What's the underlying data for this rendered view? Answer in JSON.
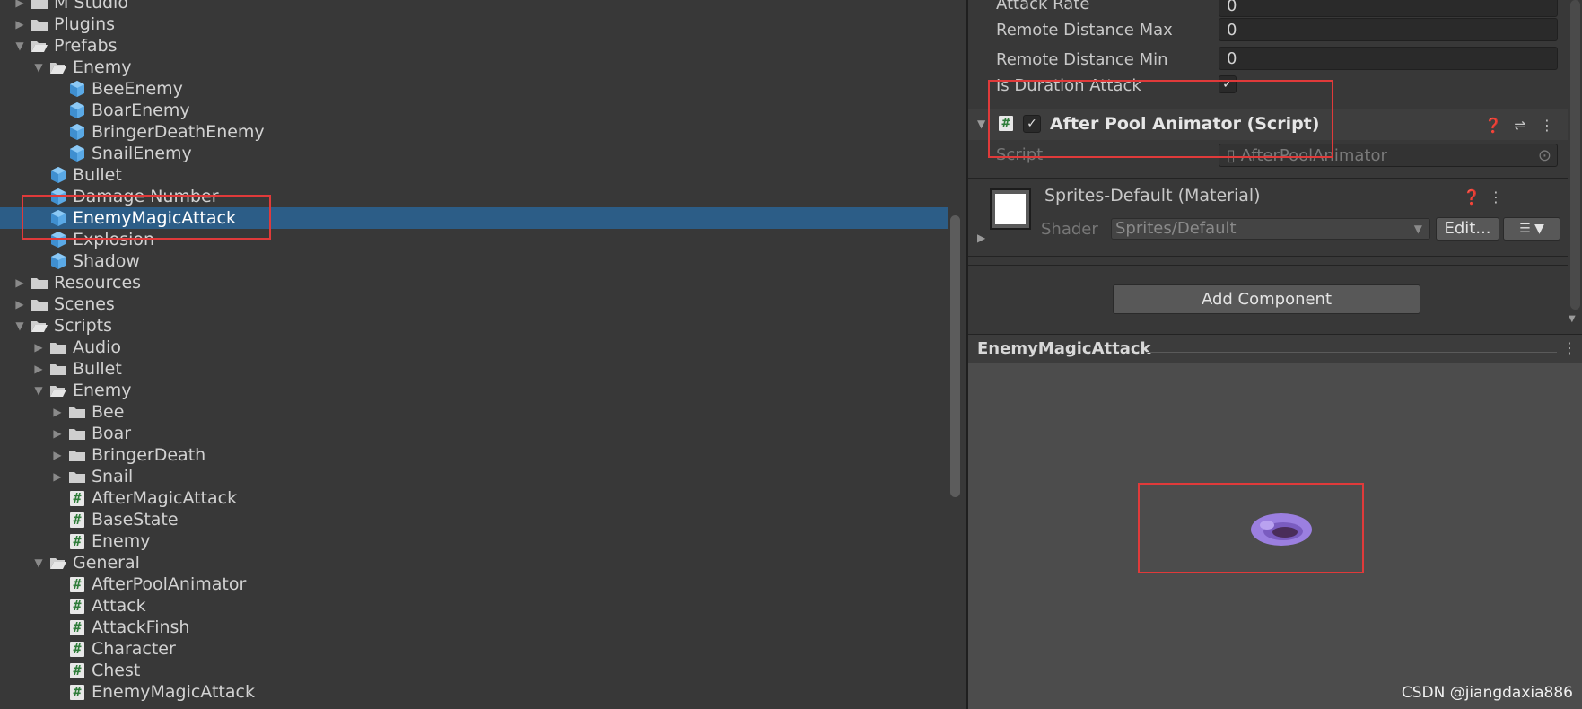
{
  "project_tree": [
    {
      "label": "M Studio",
      "depth": 0,
      "arrow": "collapsed",
      "icon": "folder-icon"
    },
    {
      "label": "Plugins",
      "depth": 0,
      "arrow": "collapsed",
      "icon": "folder-icon"
    },
    {
      "label": "Prefabs",
      "depth": 0,
      "arrow": "expanded",
      "icon": "folder-open-icon"
    },
    {
      "label": "Enemy",
      "depth": 1,
      "arrow": "expanded",
      "icon": "folder-open-icon"
    },
    {
      "label": "BeeEnemy",
      "depth": 2,
      "arrow": "none",
      "icon": "prefab-icon"
    },
    {
      "label": "BoarEnemy",
      "depth": 2,
      "arrow": "none",
      "icon": "prefab-icon"
    },
    {
      "label": "BringerDeathEnemy",
      "depth": 2,
      "arrow": "none",
      "icon": "prefab-icon"
    },
    {
      "label": "SnailEnemy",
      "depth": 2,
      "arrow": "none",
      "icon": "prefab-icon"
    },
    {
      "label": "Bullet",
      "depth": 1,
      "arrow": "none",
      "icon": "prefab-icon"
    },
    {
      "label": "Damage Number",
      "depth": 1,
      "arrow": "none",
      "icon": "prefab-icon"
    },
    {
      "label": "EnemyMagicAttack",
      "depth": 1,
      "arrow": "none",
      "icon": "prefab-icon",
      "selected": true
    },
    {
      "label": "Explosion",
      "depth": 1,
      "arrow": "none",
      "icon": "prefab-icon"
    },
    {
      "label": "Shadow",
      "depth": 1,
      "arrow": "none",
      "icon": "prefab-icon"
    },
    {
      "label": "Resources",
      "depth": 0,
      "arrow": "collapsed",
      "icon": "folder-icon"
    },
    {
      "label": "Scenes",
      "depth": 0,
      "arrow": "collapsed",
      "icon": "folder-icon"
    },
    {
      "label": "Scripts",
      "depth": 0,
      "arrow": "expanded",
      "icon": "folder-open-icon"
    },
    {
      "label": "Audio",
      "depth": 1,
      "arrow": "collapsed",
      "icon": "folder-icon"
    },
    {
      "label": "Bullet",
      "depth": 1,
      "arrow": "collapsed",
      "icon": "folder-icon"
    },
    {
      "label": "Enemy",
      "depth": 1,
      "arrow": "expanded",
      "icon": "folder-open-icon"
    },
    {
      "label": "Bee",
      "depth": 2,
      "arrow": "collapsed",
      "icon": "folder-icon"
    },
    {
      "label": "Boar",
      "depth": 2,
      "arrow": "collapsed",
      "icon": "folder-icon"
    },
    {
      "label": "BringerDeath",
      "depth": 2,
      "arrow": "collapsed",
      "icon": "folder-icon"
    },
    {
      "label": "Snail",
      "depth": 2,
      "arrow": "collapsed",
      "icon": "folder-icon"
    },
    {
      "label": "AfterMagicAttack",
      "depth": 2,
      "arrow": "none",
      "icon": "script-icon"
    },
    {
      "label": "BaseState",
      "depth": 2,
      "arrow": "none",
      "icon": "script-icon"
    },
    {
      "label": "Enemy",
      "depth": 2,
      "arrow": "none",
      "icon": "script-icon"
    },
    {
      "label": "General",
      "depth": 1,
      "arrow": "expanded",
      "icon": "folder-open-icon"
    },
    {
      "label": "AfterPoolAnimator",
      "depth": 2,
      "arrow": "none",
      "icon": "script-icon"
    },
    {
      "label": "Attack",
      "depth": 2,
      "arrow": "none",
      "icon": "script-icon"
    },
    {
      "label": "AttackFinsh",
      "depth": 2,
      "arrow": "none",
      "icon": "script-icon"
    },
    {
      "label": "Character",
      "depth": 2,
      "arrow": "none",
      "icon": "script-icon"
    },
    {
      "label": "Chest",
      "depth": 2,
      "arrow": "none",
      "icon": "script-icon"
    },
    {
      "label": "EnemyMagicAttack",
      "depth": 2,
      "arrow": "none",
      "icon": "script-icon"
    }
  ],
  "inspector": {
    "properties": [
      {
        "label": "Attack Rate",
        "value": "0"
      },
      {
        "label": "Remote Distance Max",
        "value": "0"
      },
      {
        "label": "Remote Distance Min",
        "value": "0"
      }
    ],
    "duration_attack": {
      "label": "Is Duration Attack",
      "checked": true
    },
    "component": {
      "title": "After Pool Animator (Script)",
      "enabled": true,
      "script_label": "Script",
      "script_value": "AfterPoolAnimator"
    },
    "material": {
      "title": "Sprites-Default (Material)",
      "shader_label": "Shader",
      "shader_value": "Sprites/Default",
      "edit_label": "Edit..."
    },
    "add_component_label": "Add Component"
  },
  "preview": {
    "title": "EnemyMagicAttack",
    "sprite_color": "#9b7fe0"
  },
  "watermark": "CSDN @jiangdaxia886",
  "colors": {
    "selection": "#2c5d87",
    "highlight_box": "#e03a3a"
  }
}
